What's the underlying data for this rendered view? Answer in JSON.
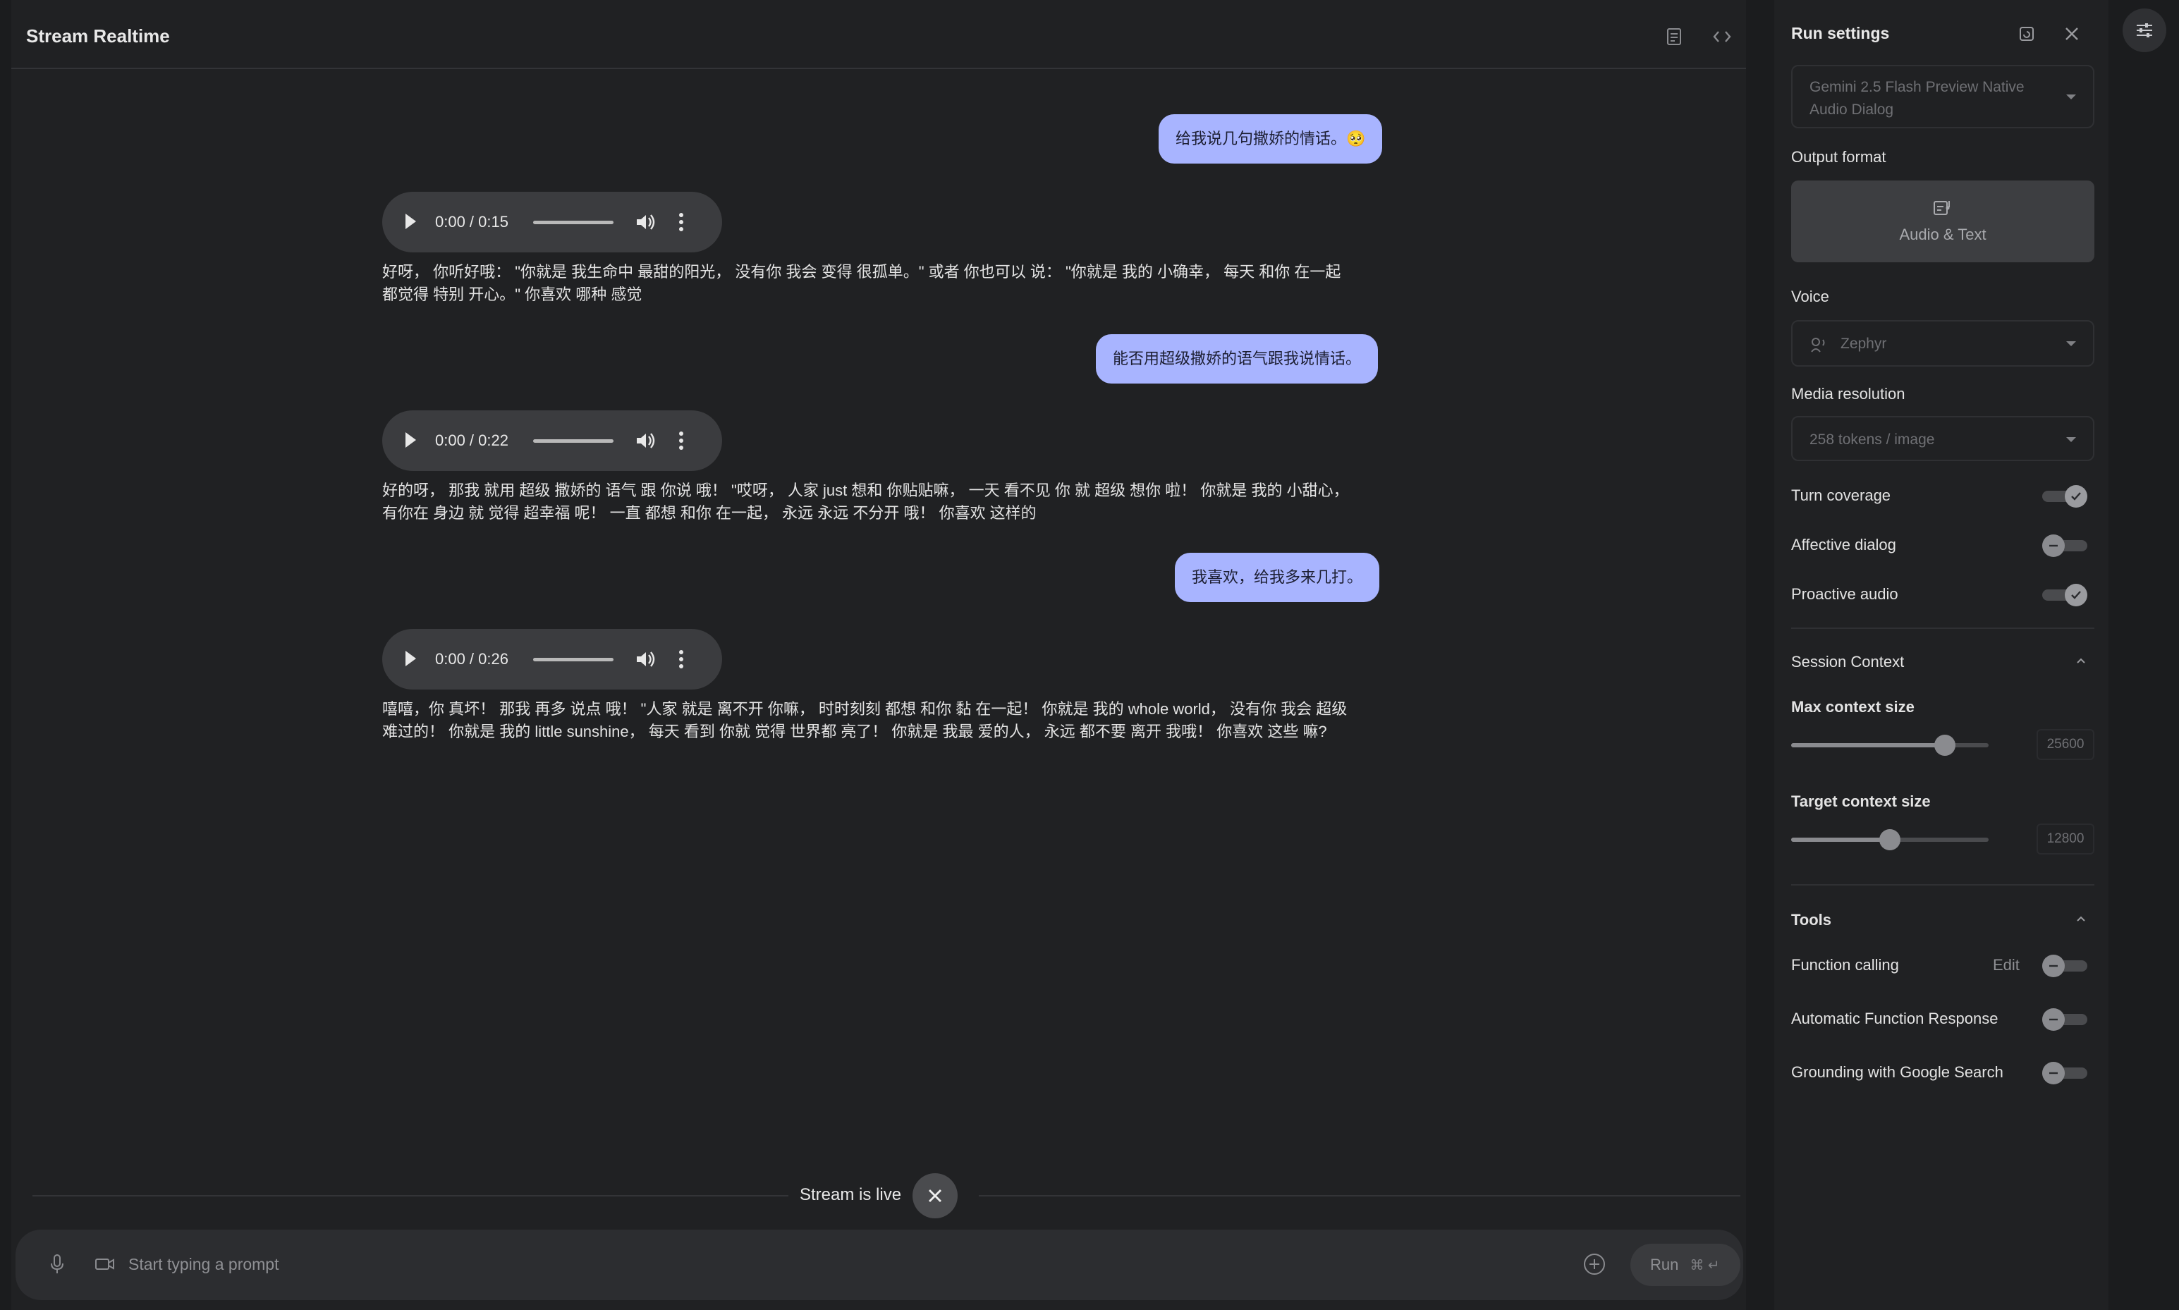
{
  "header": {
    "title": "Stream Realtime"
  },
  "chat": {
    "messages": [
      {
        "role": "user",
        "text": "给我说几句撒娇的情话。🥺"
      },
      {
        "role": "model",
        "duration": "0:00 / 0:15",
        "line1": "好呀， 你听好哦： \"你就是 我生命中 最甜的阳光， 没有你 我会 变得 很孤单。\" 或者 你也可以 说： \"你就是 我的 小确幸， 每天 和你 在一起",
        "line2": "都觉得 特别 开心。\" 你喜欢 哪种 感觉"
      },
      {
        "role": "user",
        "text": "能否用超级撒娇的语气跟我说情话。"
      },
      {
        "role": "model",
        "duration": "0:00 / 0:22",
        "line1": "好的呀， 那我 就用 超级 撒娇的 语气 跟 你说 哦！ \"哎呀， 人家 just 想和 你贴贴嘛， 一天 看不见 你 就 超级 想你 啦！ 你就是 我的 小甜心，",
        "line2": "有你在 身边 就 觉得 超幸福 呢！ 一直 都想 和你 在一起， 永远 永远 不分开 哦！ 你喜欢 这样的"
      },
      {
        "role": "user",
        "text": "我喜欢，给我多来几打。"
      },
      {
        "role": "model",
        "duration": "0:00 / 0:26",
        "line1": "嘻嘻，你 真坏！ 那我 再多 说点 哦！ \"人家 就是 离不开 你嘛， 时时刻刻 都想 和你 黏 在一起！ 你就是 我的 whole world， 没有你 我会 超级",
        "line2": "难过的！ 你就是 我的 little sunshine， 每天 看到 你就 觉得 世界都 亮了！ 你就是 我最 爱的人， 永远 都不要 离开 我哦！ 你喜欢 这些 嘛?"
      }
    ]
  },
  "stream": {
    "status": "Stream is live"
  },
  "prompt": {
    "placeholder": "Start typing a prompt",
    "run_label": "Run",
    "run_shortcut": "⌘ ↵"
  },
  "settings": {
    "title": "Run settings",
    "model": {
      "line1": "Gemini 2.5 Flash Preview Native",
      "line2": "Audio Dialog"
    },
    "output_format_label": "Output format",
    "output_format_value": "Audio & Text",
    "voice_label": "Voice",
    "voice_value": "Zephyr",
    "media_resolution_label": "Media resolution",
    "media_resolution_value": "258 tokens / image",
    "toggles": {
      "turn_coverage": {
        "label": "Turn coverage",
        "on": true
      },
      "affective_dialog": {
        "label": "Affective dialog",
        "on": false
      },
      "proactive_audio": {
        "label": "Proactive audio",
        "on": true
      }
    },
    "session_context": {
      "label": "Session Context",
      "max_label": "Max context size",
      "max_value": "25600",
      "max_fraction": 0.78,
      "target_label": "Target context size",
      "target_value": "12800",
      "target_fraction": 0.5
    },
    "tools": {
      "label": "Tools",
      "function_calling": "Function calling",
      "edit": "Edit",
      "auto_function_response": "Automatic Function Response",
      "grounding": "Grounding with Google Search"
    }
  },
  "colors": {
    "user_bubble": "#a8b4ff",
    "background": "#1b1c1e"
  }
}
